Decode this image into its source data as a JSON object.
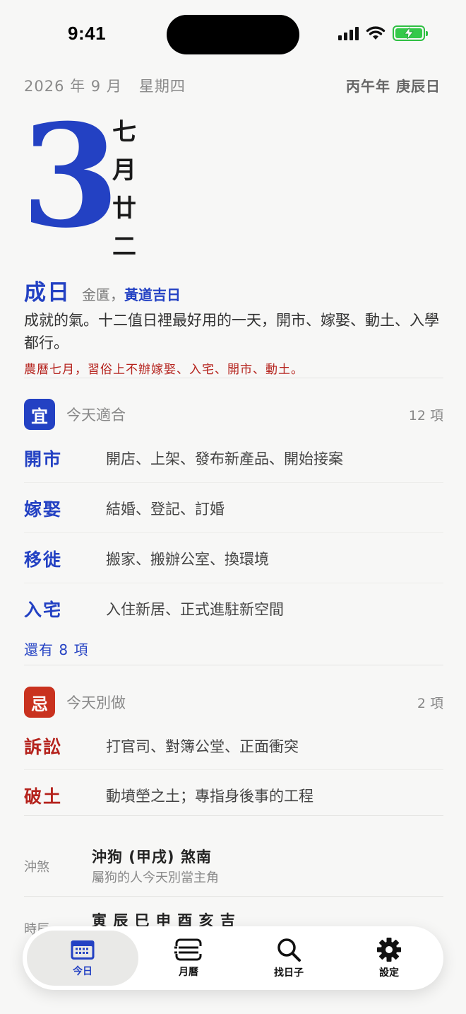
{
  "status": {
    "time": "9:41"
  },
  "header": {
    "date_text": "2026 年 9 月",
    "weekday": "星期四",
    "ganzhi": "丙午年 庚辰日",
    "day_number": "3",
    "lunar_chars": [
      "七",
      "月",
      "廿",
      "二"
    ]
  },
  "day": {
    "name": "成日",
    "god": "金匱，",
    "auspicious": "黃道吉日",
    "description": "成就的氣。十二值日裡最好用的一天，開市、嫁娶、動土、入學都行。",
    "warning": "農曆七月，習俗上不辦嫁娶、入宅、開市、動土。"
  },
  "good": {
    "badge": "宜",
    "label": "今天適合",
    "count": "12 項",
    "items": [
      {
        "name": "開市",
        "desc": "開店、上架、發布新產品、開始接案"
      },
      {
        "name": "嫁娶",
        "desc": "結婚、登記、訂婚"
      },
      {
        "name": "移徙",
        "desc": "搬家、搬辦公室、換環境"
      },
      {
        "name": "入宅",
        "desc": "入住新居、正式進駐新空間"
      }
    ],
    "more": "還有 8 項"
  },
  "bad": {
    "badge": "忌",
    "label": "今天別做",
    "count": "2 項",
    "items": [
      {
        "name": "訴訟",
        "desc": "打官司、對簿公堂、正面衝突"
      },
      {
        "name": "破土",
        "desc": "動墳塋之土；專指身後事的工程"
      }
    ]
  },
  "info": {
    "clash_label": "沖煞",
    "clash_main": "沖狗 (甲戌) 煞南",
    "clash_sub": "屬狗的人今天別當主角",
    "hours_label": "時辰",
    "hours_main": "寅 辰 巳 申 酉 亥 吉"
  },
  "tabbar": {
    "tabs": [
      {
        "label": "今日",
        "icon": "calendar-today-icon"
      },
      {
        "label": "月曆",
        "icon": "month-calendar-icon"
      },
      {
        "label": "找日子",
        "icon": "search-icon"
      },
      {
        "label": "設定",
        "icon": "gear-icon"
      }
    ]
  },
  "colors": {
    "accent": "#2341c3",
    "danger": "#b5231d",
    "battery": "#35c94a"
  }
}
